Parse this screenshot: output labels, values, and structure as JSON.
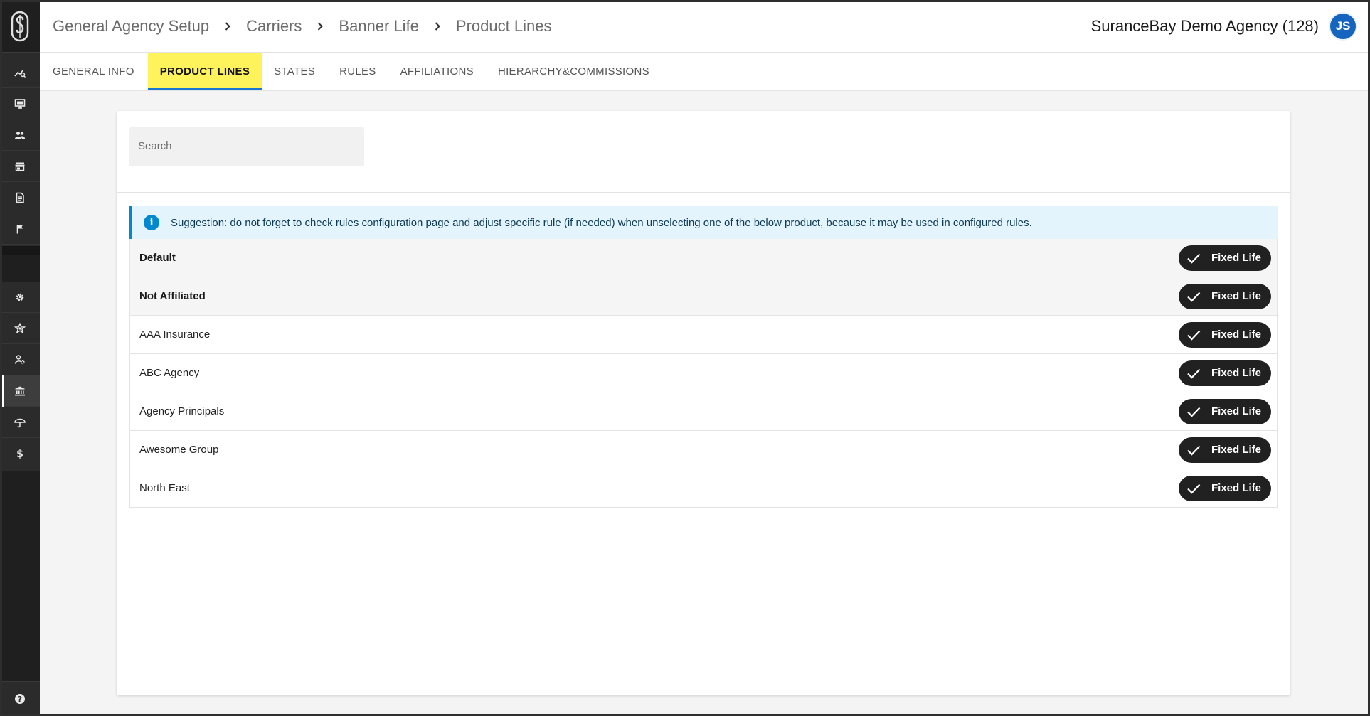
{
  "app": {
    "logo_letter": "S"
  },
  "header": {
    "breadcrumbs": [
      "General Agency Setup",
      "Carriers",
      "Banner Life",
      "Product Lines"
    ],
    "agency_name": "SuranceBay Demo Agency (128)",
    "avatar_initials": "JS",
    "accent_color": "#1565c0"
  },
  "sidebar": {
    "top_items": [
      {
        "icon": "analytics-icon"
      },
      {
        "icon": "monitor-icon"
      },
      {
        "icon": "people-icon"
      },
      {
        "icon": "store-icon"
      },
      {
        "icon": "document-icon"
      },
      {
        "icon": "flag-icon"
      }
    ],
    "bottom_items": [
      {
        "icon": "gear-icon",
        "active": false
      },
      {
        "icon": "star-badge-icon",
        "active": false
      },
      {
        "icon": "user-settings-icon",
        "active": false
      },
      {
        "icon": "bank-icon",
        "active": true
      },
      {
        "icon": "umbrella-icon",
        "active": false
      },
      {
        "icon": "dollar-icon",
        "active": false
      }
    ],
    "help_icon": "help-icon"
  },
  "tabs": [
    {
      "label": "GENERAL INFO",
      "active": false
    },
    {
      "label": "PRODUCT LINES",
      "active": true
    },
    {
      "label": "STATES",
      "active": false
    },
    {
      "label": "RULES",
      "active": false
    },
    {
      "label": "AFFILIATIONS",
      "active": false
    },
    {
      "label": "HIERARCHY&COMMISSIONS",
      "active": false
    }
  ],
  "tab_highlight_color": "#fff35c",
  "search": {
    "placeholder": "Search",
    "value": ""
  },
  "alert": {
    "text": "Suggestion: do not forget to check rules configuration page and adjust specific rule (if needed) when unselecting one of the below product, because it may be used in configured rules.",
    "color": "#0288d1"
  },
  "rows": [
    {
      "label": "Default",
      "group": true,
      "chip": "Fixed Life",
      "selected": true
    },
    {
      "label": "Not Affiliated",
      "group": true,
      "chip": "Fixed Life",
      "selected": true
    },
    {
      "label": "AAA Insurance",
      "group": false,
      "chip": "Fixed Life",
      "selected": true
    },
    {
      "label": "ABC Agency",
      "group": false,
      "chip": "Fixed Life",
      "selected": true
    },
    {
      "label": "Agency Principals",
      "group": false,
      "chip": "Fixed Life",
      "selected": true
    },
    {
      "label": "Awesome Group",
      "group": false,
      "chip": "Fixed Life",
      "selected": true
    },
    {
      "label": "North East",
      "group": false,
      "chip": "Fixed Life",
      "selected": true
    }
  ]
}
